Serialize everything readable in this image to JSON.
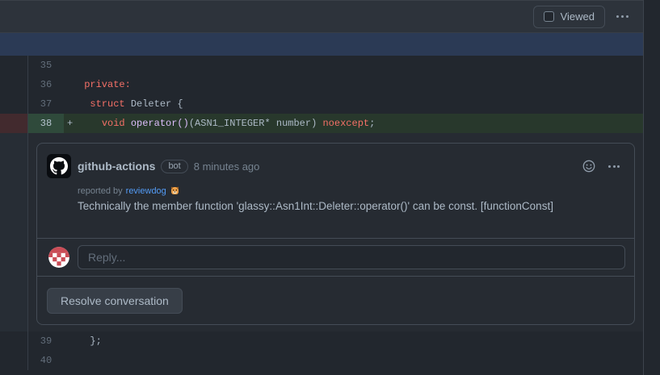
{
  "toolbar": {
    "viewed_label": "Viewed"
  },
  "diff": {
    "numbers": {
      "n35": "35",
      "n36": "36",
      "n37": "37",
      "n38": "38",
      "n39": "39",
      "n40": "40"
    },
    "row36": {
      "indent": " ",
      "keyword": "private:"
    },
    "row37": {
      "indent": "  ",
      "keyword": "struct",
      "rest": " Deleter {"
    },
    "row38": {
      "sign": "+",
      "indent": "    ",
      "keyword1": "void",
      "function": " operator()",
      "params": "(ASN1_INTEGER* number) ",
      "keyword2": "noexcept",
      "tail": ";"
    },
    "row39": {
      "code": "  };"
    }
  },
  "thread": {
    "author": "github-actions",
    "bot_badge": "bot",
    "timestamp": "8 minutes ago",
    "reported_by": "reported by",
    "reporter_link": "reviewdog",
    "reporter_emoji": "🐶",
    "body": "Technically the member function 'glassy::Asn1Int::Deleter::operator()' can be const. [functionConst]",
    "reply_placeholder": "Reply...",
    "resolve_button": "Resolve conversation"
  },
  "colors": {
    "addition_line_bg": "#28382c",
    "addition_gutter_bg": "#2f4a3b",
    "deletion_marker_bg": "#422a2e",
    "hunk_header_bg": "#2b3a55",
    "keyword_color": "#f47067",
    "function_color": "#dcbdfb",
    "link_color": "#539bf5"
  }
}
